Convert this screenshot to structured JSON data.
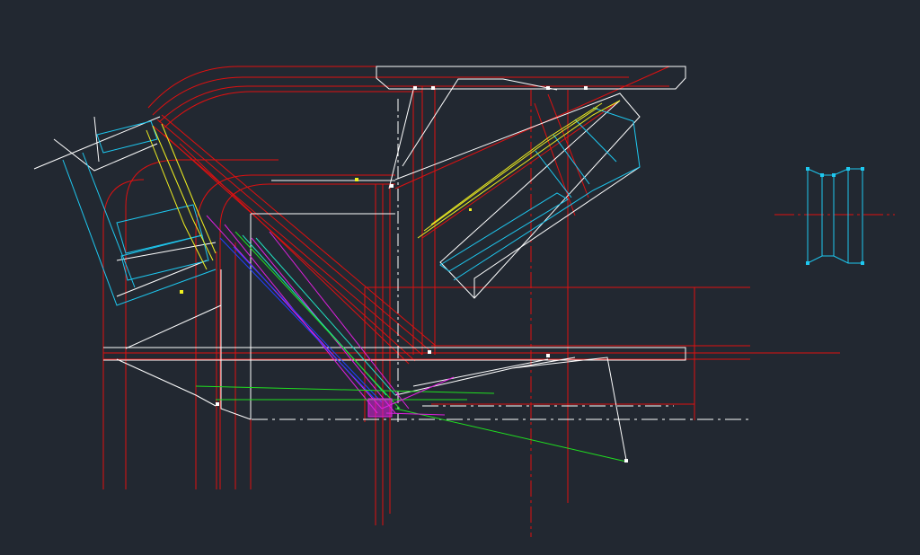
{
  "drawing": {
    "background": "#222831",
    "layers": {
      "outline": "#ffffff",
      "centerline": "#e01010",
      "idler": "#1ec8f0",
      "belt": "#f0f020",
      "flow_magenta": "#e020e0",
      "flow_green": "#20e020",
      "flow_blue": "#2040ff",
      "flow_cyan": "#20e0c0"
    }
  }
}
